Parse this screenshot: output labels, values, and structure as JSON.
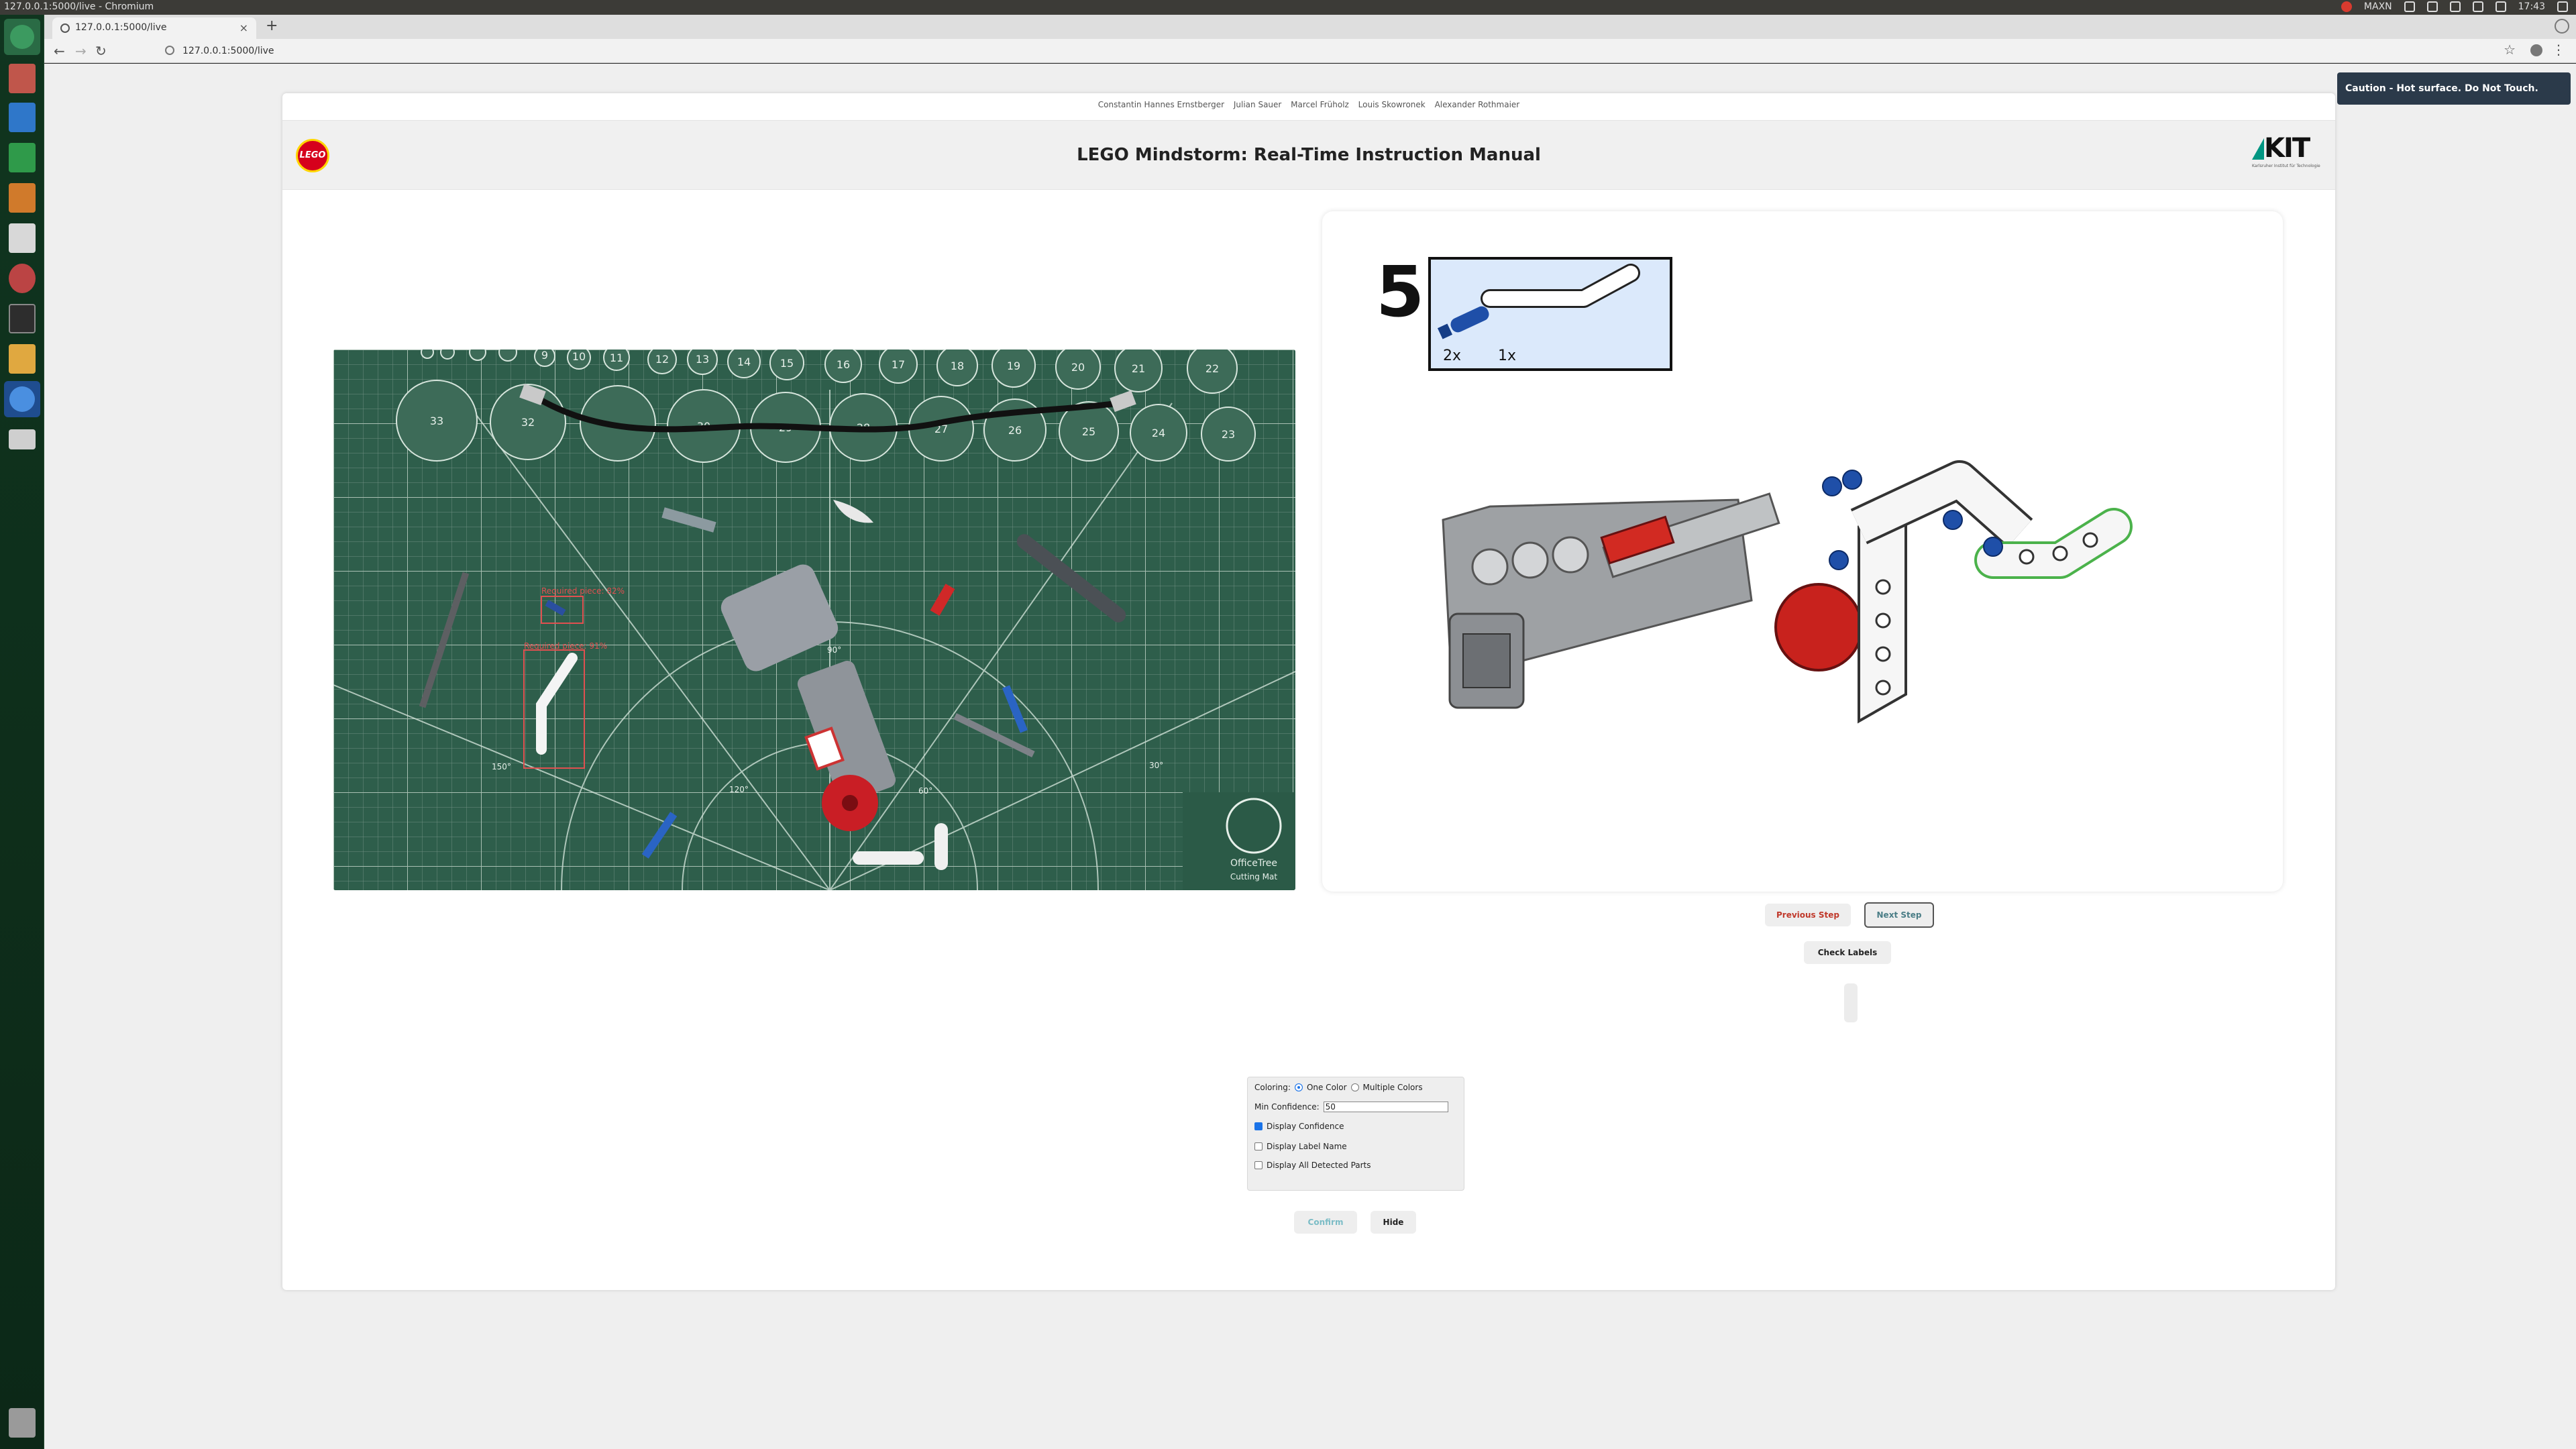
{
  "system": {
    "window_title": "127.0.0.1:5000/live - Chromium",
    "tray_user": "MAXN",
    "clock": "17:43"
  },
  "browser": {
    "tab_title": "127.0.0.1:5000/live",
    "url": "127.0.0.1:5000/live"
  },
  "toast": {
    "message": "Caution - Hot surface. Do Not Touch."
  },
  "page": {
    "authors": [
      "Constantin Hannes Ernstberger",
      "Julian Sauer",
      "Marcel Früholz",
      "Louis Skowronek",
      "Alexander Rothmaier"
    ],
    "logo_left": "LEGO",
    "title": "LEGO Mindstorm: Real-Time Instruction Manual",
    "logo_right": "KIT",
    "logo_right_sub": "Karlsruher Institut für Technologie"
  },
  "camera": {
    "mat_numbers": [
      "9",
      "10",
      "11",
      "12",
      "13",
      "14",
      "15",
      "16",
      "17",
      "18",
      "19",
      "20",
      "21",
      "22",
      "33",
      "32",
      "30",
      "29",
      "28",
      "27",
      "26",
      "25",
      "24",
      "23"
    ],
    "angles": [
      "90°",
      "150°",
      "120°",
      "60°",
      "30°"
    ],
    "detections": [
      {
        "label": "Required piece: 82%"
      },
      {
        "label": "Required piece: 91%"
      }
    ],
    "brand": "OfficeTree",
    "brand_sub": "Cutting Mat"
  },
  "instruction": {
    "step_number": "5",
    "parts": [
      {
        "qty": "2x",
        "color": "#1f4fa8"
      },
      {
        "qty": "1x",
        "color": "#ffffff"
      }
    ]
  },
  "controls": {
    "prev_label": "Previous Step",
    "next_label": "Next Step",
    "check_label": "Check Labels"
  },
  "settings": {
    "coloring_label": "Coloring:",
    "option_one": "One Color",
    "option_multi": "Multiple Colors",
    "coloring_selected": "One Color",
    "min_conf_label": "Min Confidence:",
    "min_conf_value": "50",
    "display_confidence": "Display Confidence",
    "display_confidence_checked": true,
    "display_label_name": "Display Label Name",
    "display_label_name_checked": false,
    "display_all": "Display All Detected Parts",
    "display_all_checked": false,
    "confirm_label": "Confirm",
    "hide_label": "Hide"
  },
  "colors": {
    "mat_green": "#2e5e4b",
    "lego_red": "#d6001c",
    "kit_green": "#009682",
    "detection_red": "#e05050",
    "parts_box_bg": "#dbe9fb"
  }
}
